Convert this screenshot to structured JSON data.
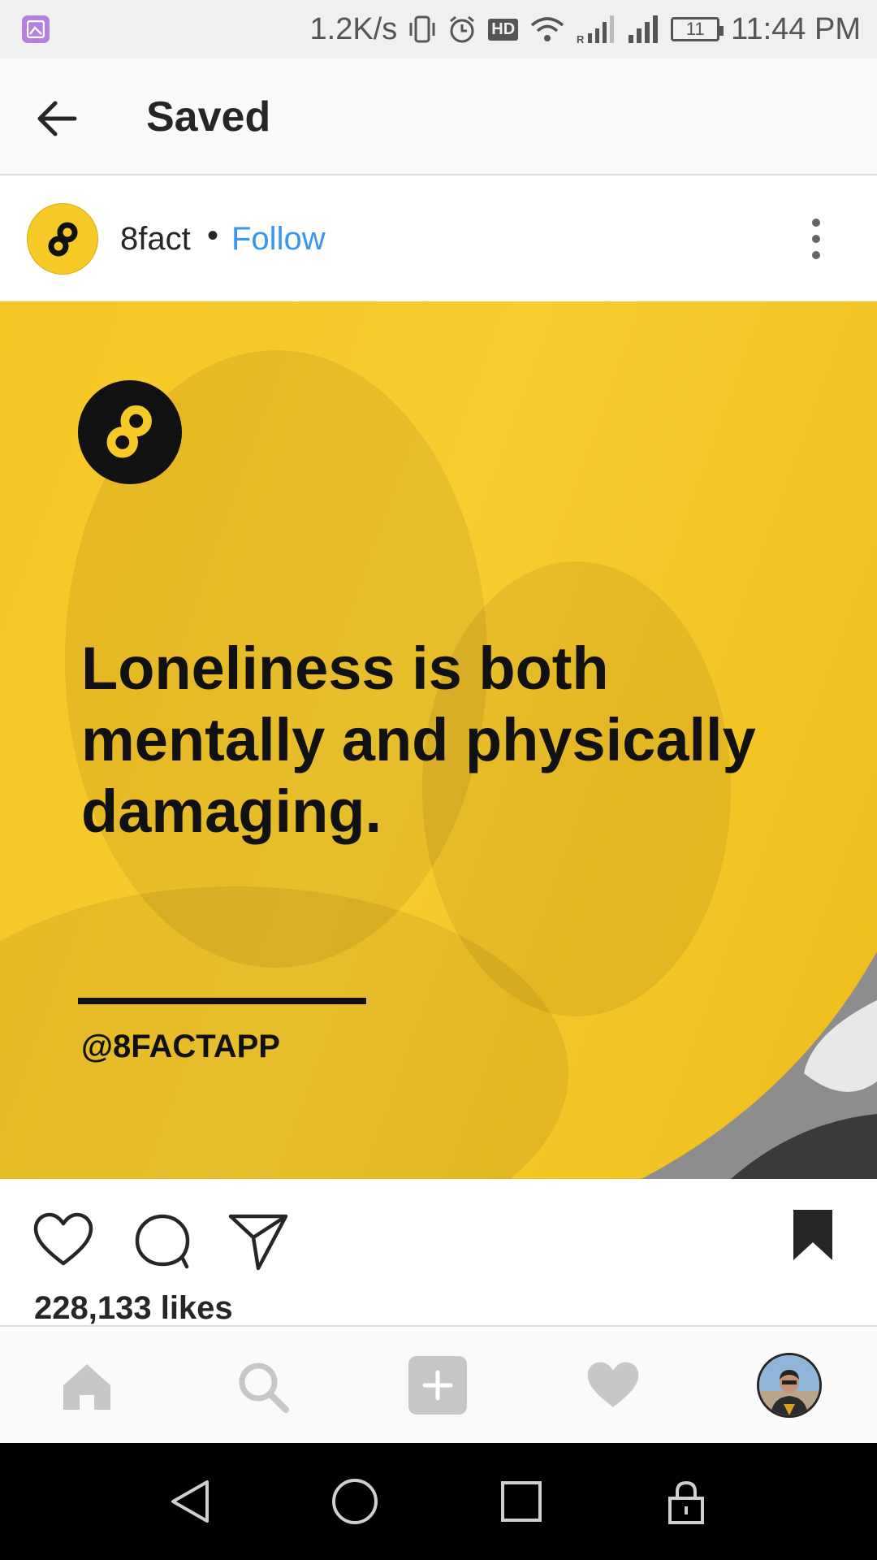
{
  "status_bar": {
    "network_speed": "1.2K/s",
    "hd_label": "HD",
    "battery_level": "11",
    "time": "11:44 PM"
  },
  "header": {
    "title": "Saved"
  },
  "post": {
    "username": "8fact",
    "separator": "•",
    "follow_label": "Follow",
    "quote": "Loneliness is both mentally and physically damaging.",
    "handle": "@8FACTAPP",
    "likes": "228,133 likes"
  },
  "colors": {
    "brand_yellow": "#f6c927",
    "follow_blue": "#3897f0",
    "text_dark": "#262626"
  },
  "bottom_nav": {
    "items": [
      "home-icon",
      "search-icon",
      "add-icon",
      "activity-heart-icon",
      "profile-avatar"
    ]
  },
  "system_nav": {
    "items": [
      "back-icon",
      "home-circle-icon",
      "recents-square-icon",
      "lock-icon"
    ]
  }
}
